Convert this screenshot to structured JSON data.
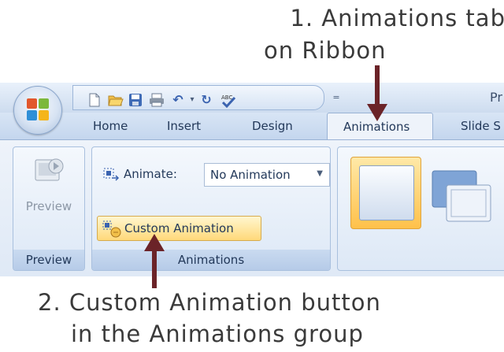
{
  "callouts": {
    "one_line1": "1. Animations tab",
    "one_line2": "on Ribbon",
    "two_line1": "2. Custom Animation button",
    "two_line2": "in the Animations group"
  },
  "window": {
    "title_partial": "Pr"
  },
  "tabs": [
    "Home",
    "Insert",
    "Design",
    "Animations",
    "Slide S"
  ],
  "groups": {
    "preview": {
      "label": "Preview",
      "button_label": "Preview"
    },
    "animations": {
      "label": "Animations",
      "animate_label": "Animate:",
      "animate_value": "No Animation",
      "custom_button": "Custom Animation"
    }
  },
  "icons": [
    "office-orb-icon",
    "new-icon",
    "open-icon",
    "save-icon",
    "print-icon",
    "undo-icon",
    "redo-icon",
    "spelling-icon",
    "qat-dropdown-icon",
    "preview-icon",
    "animate-icon",
    "custom-animation-icon",
    "dropdown-arrow-icon"
  ],
  "colors": {
    "arrow": "#6b2328",
    "ribbon_blue": "#dfe9f6",
    "highlight": "#ffd97a"
  }
}
